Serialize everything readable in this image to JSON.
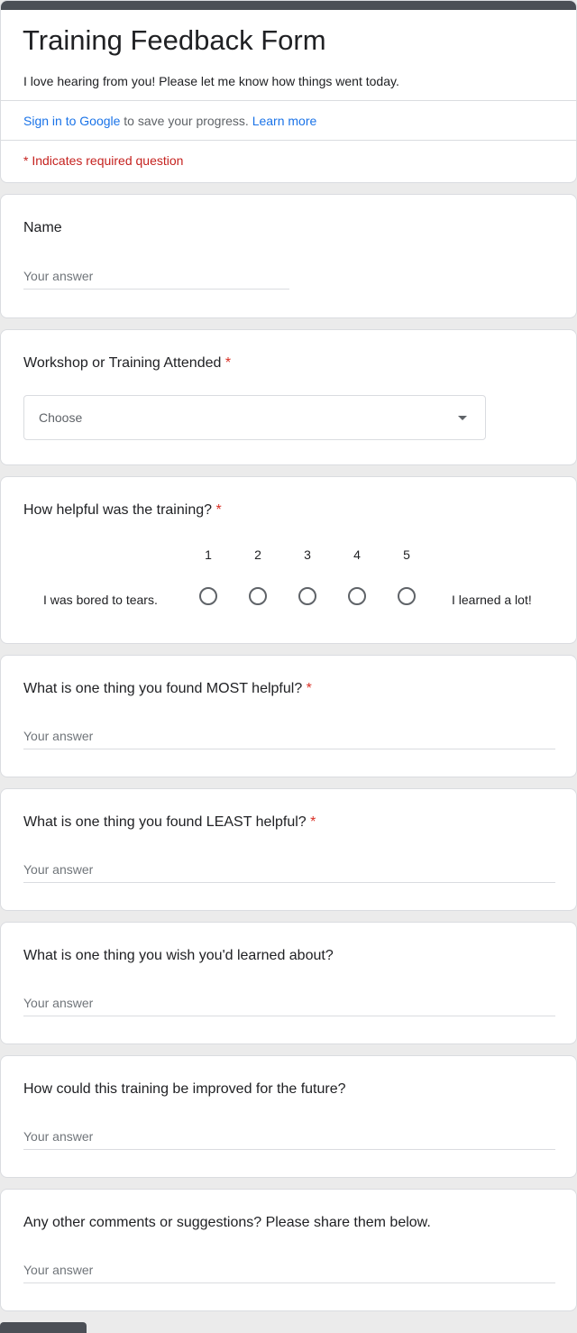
{
  "header": {
    "title": "Training Feedback Form",
    "description": "I love hearing from you! Please let me know how things went today.",
    "signin_link": "Sign in to Google",
    "signin_text": " to save your progress. ",
    "learn_more": "Learn more",
    "required_note": "* Indicates required question",
    "accent_color": "#4b4f56"
  },
  "questions": {
    "name": {
      "title": "Name",
      "placeholder": "Your answer"
    },
    "workshop": {
      "title": "Workshop or Training Attended",
      "required_mark": "*",
      "select_value": "Choose"
    },
    "helpful": {
      "title": "How helpful was the training?",
      "required_mark": "*",
      "scale": [
        "1",
        "2",
        "3",
        "4",
        "5"
      ],
      "low_label": "I was bored to tears.",
      "high_label": "I learned a lot!"
    },
    "most": {
      "title": "What is one thing you found MOST helpful?",
      "required_mark": "*",
      "placeholder": "Your answer"
    },
    "least": {
      "title": "What is one thing you found LEAST helpful?",
      "required_mark": "*",
      "placeholder": "Your answer"
    },
    "wish": {
      "title": "What is one thing you wish you'd learned about?",
      "placeholder": "Your answer"
    },
    "improve": {
      "title": "How could this training be improved for the future?",
      "placeholder": "Your answer"
    },
    "comments": {
      "title": "Any other comments or suggestions?  Please share them below.",
      "placeholder": "Your answer"
    }
  }
}
